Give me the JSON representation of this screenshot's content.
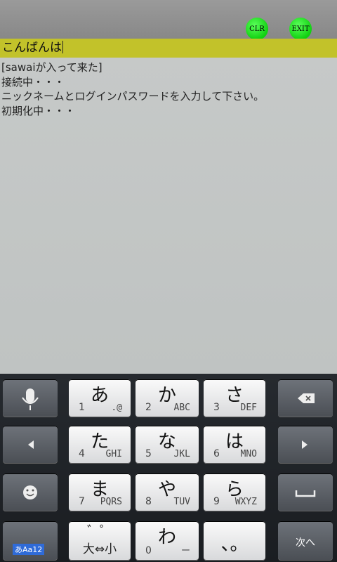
{
  "top_bar": {
    "clr_label": "CLR",
    "exit_label": "EXIT"
  },
  "input": {
    "value": "こんばんは"
  },
  "log": [
    "[sawaiが入って来た]",
    "接続中・・・",
    "ニックネームとログインパスワードを入力して下さい。",
    "初期化中・・・"
  ],
  "keyboard": {
    "keys": [
      {
        "kana": "あ",
        "num": "1",
        "alpha": ".@"
      },
      {
        "kana": "か",
        "num": "2",
        "alpha": "ABC"
      },
      {
        "kana": "さ",
        "num": "3",
        "alpha": "DEF"
      },
      {
        "kana": "た",
        "num": "4",
        "alpha": "GHI"
      },
      {
        "kana": "な",
        "num": "5",
        "alpha": "JKL"
      },
      {
        "kana": "は",
        "num": "6",
        "alpha": "MNO"
      },
      {
        "kana": "ま",
        "num": "7",
        "alpha": "PQRS"
      },
      {
        "kana": "や",
        "num": "8",
        "alpha": "TUV"
      },
      {
        "kana": "ら",
        "num": "9",
        "alpha": "WXYZ"
      },
      {
        "kana": "゛゜",
        "sub": "大⇔小"
      },
      {
        "kana": "わ",
        "num": "0",
        "alpha": "ー"
      },
      {
        "kana": "、。",
        "num": "",
        "alpha": ""
      }
    ],
    "mode_label": "あAa12",
    "next_label": "次へ",
    "icons": {
      "mic": "microphone-icon",
      "backspace": "backspace-icon",
      "left": "cursor-left-icon",
      "right": "cursor-right-icon",
      "emoji": "emoji-icon",
      "space": "space-icon"
    }
  }
}
